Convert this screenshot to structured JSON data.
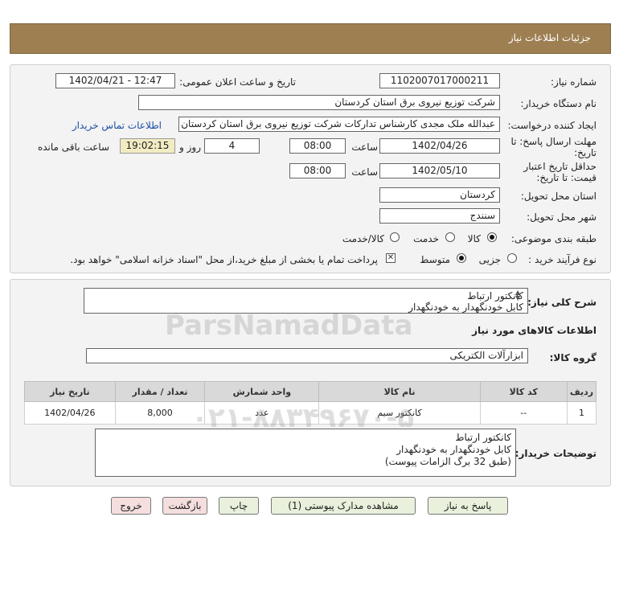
{
  "header": {
    "title": "جزئیات اطلاعات نیاز"
  },
  "fields": {
    "need_number_label": "شماره نیاز:",
    "need_number": "1102007017000211",
    "announce_label": "تاریخ و ساعت اعلان عمومی:",
    "announce_value": "1402/04/21 - 12:47",
    "buyer_org_label": "نام دستگاه خریدار:",
    "buyer_org": "شرکت توزیع نیروی برق استان کردستان",
    "creator_label": "ایجاد کننده درخواست:",
    "creator": "عبدالله ملک مجدی کارشناس تدارکات شرکت توزیع نیروی برق استان کردستان",
    "contact_link": "اطلاعات تماس خریدار",
    "deadline_label": "مهلت ارسال پاسخ: تا تاریخ:",
    "deadline_date": "1402/04/26",
    "time_label": "ساعت",
    "deadline_time": "08:00",
    "days_value": "4",
    "days_label": "روز و",
    "remaining_time": "19:02:15",
    "remaining_label": "ساعت باقی مانده",
    "validity_label": "حداقل تاریخ اعتبار قیمت: تا تاریخ:",
    "validity_date": "1402/05/10",
    "validity_time": "08:00",
    "province_label": "استان محل تحویل:",
    "province": "کردستان",
    "city_label": "شهر محل تحویل:",
    "city": "سنندج",
    "category_label": "طبقه بندی موضوعی:",
    "category_options": [
      "کالا",
      "خدمت",
      "کالا/خدمت"
    ],
    "process_label": "نوع فرآیند خرید :",
    "process_options": [
      "جزیی",
      "متوسط"
    ],
    "payment_note": "پرداخت تمام یا بخشی از مبلغ خرید،از محل \"اسناد خزانه اسلامی\" خواهد بود."
  },
  "summary": {
    "label": "شرح کلی نیاز:",
    "line1": "کانکتور ارتباط",
    "line2": "کابل خودنگهدار به خودنگهدار"
  },
  "goods": {
    "section_title": "اطلاعات کالاهای مورد نیاز",
    "group_label": "گروه کالا:",
    "group_value": "ابزارآلات الکتریکی",
    "columns": [
      "ردیف",
      "کد کالا",
      "نام کالا",
      "واحد شمارش",
      "تعداد / مقدار",
      "تاریخ نیاز"
    ],
    "rows": [
      {
        "row": "1",
        "code": "--",
        "name": "کانکتور سیم",
        "unit": "عدد",
        "qty": "8,000",
        "date": "1402/04/26"
      }
    ]
  },
  "buyer_notes": {
    "label": "توضیحات خریدار:",
    "line1": "کانکتور ارتباط",
    "line2": "کابل خودنگهدار به خودنگهدار",
    "line3": "(طبق 32 برگ الزامات پیوست)"
  },
  "buttons": {
    "reply": "پاسخ به نیاز",
    "attachments": "مشاهده مدارک پیوستی (1)",
    "print": "چاپ",
    "back": "بازگشت",
    "exit": "خروج"
  },
  "watermark": {
    "brand": "ParsNamadData",
    "phone": "۰۲۱-۸۸۳۴۹۶۷۰-۵"
  },
  "colors": {
    "header_bg": "#9e7f52",
    "timer_bg": "#f2ecc2",
    "link": "#1c4fa8",
    "button_bg": "#e9f1dc",
    "button_red_bg": "#f5dede"
  }
}
